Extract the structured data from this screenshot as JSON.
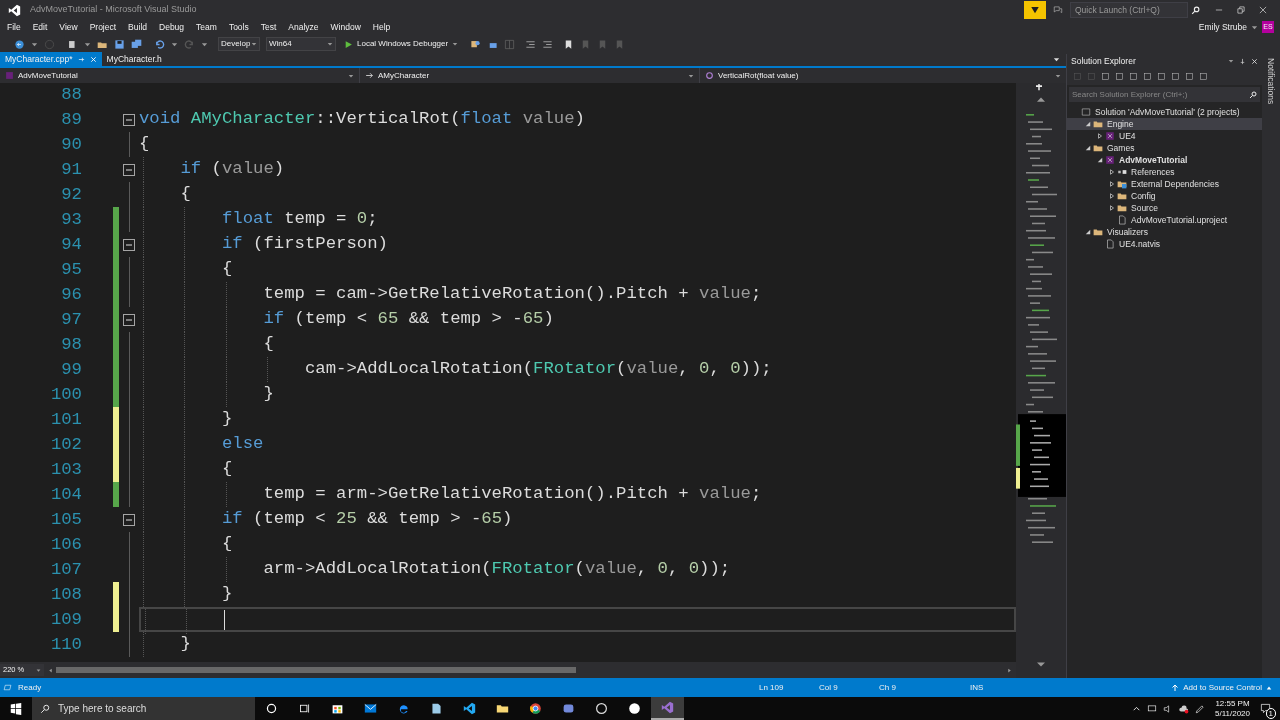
{
  "window": {
    "title": "AdvMoveTutorial - Microsoft Visual Studio"
  },
  "quick_launch": {
    "placeholder": "Quick Launch (Ctrl+Q)"
  },
  "menu": [
    "File",
    "Edit",
    "View",
    "Project",
    "Build",
    "Debug",
    "Team",
    "Tools",
    "Test",
    "Analyze",
    "Window",
    "Help"
  ],
  "account": {
    "name": "Emily Strube",
    "initials": "ES"
  },
  "toolbar": {
    "configuration": "Develop",
    "platform": "Win64",
    "debugger": "Local Windows Debugger"
  },
  "tabs": [
    {
      "label": "MyCharacter.cpp*",
      "selected": true
    },
    {
      "label": "MyCharacter.h",
      "selected": false
    }
  ],
  "navigation": {
    "project": "AdvMoveTutorial",
    "class": "AMyCharacter",
    "member": "VerticalRot(float value)"
  },
  "editor": {
    "zoom": "220 %",
    "lines": [
      {
        "number": "88",
        "fold": false,
        "current": false
      },
      {
        "number": "89",
        "fold": true,
        "current": false,
        "tokens": [
          {
            "kind": "keyword",
            "text": "void"
          },
          {
            "kind": "type",
            "text": " AMyCharacter"
          },
          {
            "kind": "plain",
            "text": "::VerticalRot("
          },
          {
            "kind": "keyword",
            "text": "float"
          },
          {
            "kind": "parameter",
            "text": " value"
          },
          {
            "kind": "plain",
            "text": ")"
          }
        ]
      },
      {
        "number": "90",
        "fold": false,
        "current": false,
        "tokens": [
          {
            "kind": "plain",
            "text": "{"
          }
        ]
      },
      {
        "number": "91",
        "fold": true,
        "current": false,
        "tokens": [
          {
            "kind": "keyword",
            "text": "    if"
          },
          {
            "kind": "plain",
            "text": " ("
          },
          {
            "kind": "parameter",
            "text": "value"
          },
          {
            "kind": "plain",
            "text": ")"
          }
        ]
      },
      {
        "number": "92",
        "fold": false,
        "current": false,
        "tokens": [
          {
            "kind": "plain",
            "text": "    {"
          }
        ]
      },
      {
        "number": "93",
        "fold": false,
        "color": "#57a64a",
        "current": false,
        "tokens": [
          {
            "kind": "keyword",
            "text": "        float"
          },
          {
            "kind": "plain",
            "text": " temp = "
          },
          {
            "kind": "number",
            "text": "0"
          },
          {
            "kind": "plain",
            "text": ";"
          }
        ]
      },
      {
        "number": "94",
        "fold": true,
        "color": "#57a64a",
        "current": false,
        "tokens": [
          {
            "kind": "keyword",
            "text": "        if"
          },
          {
            "kind": "plain",
            "text": " (firstPerson)"
          }
        ]
      },
      {
        "number": "95",
        "fold": false,
        "color": "#57a64a",
        "current": false,
        "tokens": [
          {
            "kind": "plain",
            "text": "        {"
          }
        ]
      },
      {
        "number": "96",
        "fold": false,
        "color": "#57a64a",
        "current": false,
        "tokens": [
          {
            "kind": "plain",
            "text": "            temp = cam->GetRelativeRotation().Pitch + "
          },
          {
            "kind": "parameter",
            "text": "value"
          },
          {
            "kind": "plain",
            "text": ";"
          }
        ]
      },
      {
        "number": "97",
        "fold": true,
        "color": "#57a64a",
        "current": false,
        "tokens": [
          {
            "kind": "keyword",
            "text": "            if"
          },
          {
            "kind": "plain",
            "text": " (temp < "
          },
          {
            "kind": "number",
            "text": "65"
          },
          {
            "kind": "plain",
            "text": " && temp > -"
          },
          {
            "kind": "number",
            "text": "65"
          },
          {
            "kind": "plain",
            "text": ")"
          }
        ]
      },
      {
        "number": "98",
        "fold": false,
        "color": "#57a64a",
        "current": false,
        "tokens": [
          {
            "kind": "plain",
            "text": "            {"
          }
        ]
      },
      {
        "number": "99",
        "fold": false,
        "color": "#57a64a",
        "current": false,
        "tokens": [
          {
            "kind": "plain",
            "text": "                cam->AddLocalRotation("
          },
          {
            "kind": "type",
            "text": "FRotator"
          },
          {
            "kind": "plain",
            "text": "("
          },
          {
            "kind": "parameter",
            "text": "value"
          },
          {
            "kind": "plain",
            "text": ", "
          },
          {
            "kind": "number",
            "text": "0"
          },
          {
            "kind": "plain",
            "text": ", "
          },
          {
            "kind": "number",
            "text": "0"
          },
          {
            "kind": "plain",
            "text": "));"
          }
        ]
      },
      {
        "number": "100",
        "fold": false,
        "color": "#57a64a",
        "current": false,
        "tokens": [
          {
            "kind": "plain",
            "text": "            }"
          }
        ]
      },
      {
        "number": "101",
        "fold": false,
        "color": "#efef91",
        "current": false,
        "tokens": [
          {
            "kind": "plain",
            "text": "        }"
          }
        ]
      },
      {
        "number": "102",
        "fold": false,
        "color": "#efef91",
        "current": false,
        "tokens": [
          {
            "kind": "keyword",
            "text": "        else"
          }
        ]
      },
      {
        "number": "103",
        "fold": false,
        "color": "#efef91",
        "current": false,
        "tokens": [
          {
            "kind": "plain",
            "text": "        {"
          }
        ]
      },
      {
        "number": "104",
        "fold": false,
        "color": "#57a64a",
        "current": false,
        "tokens": [
          {
            "kind": "plain",
            "text": "            temp = arm->GetRelativeRotation().Pitch + "
          },
          {
            "kind": "parameter",
            "text": "value"
          },
          {
            "kind": "plain",
            "text": ";"
          }
        ]
      },
      {
        "number": "105",
        "fold": true,
        "current": false,
        "tokens": [
          {
            "kind": "keyword",
            "text": "        if"
          },
          {
            "kind": "plain",
            "text": " (temp < "
          },
          {
            "kind": "number",
            "text": "25"
          },
          {
            "kind": "plain",
            "text": " && temp > -"
          },
          {
            "kind": "number",
            "text": "65"
          },
          {
            "kind": "plain",
            "text": ")"
          }
        ]
      },
      {
        "number": "106",
        "fold": false,
        "current": false,
        "tokens": [
          {
            "kind": "plain",
            "text": "        {"
          }
        ]
      },
      {
        "number": "107",
        "fold": false,
        "current": false,
        "tokens": [
          {
            "kind": "plain",
            "text": "            arm->AddLocalRotation("
          },
          {
            "kind": "type",
            "text": "FRotator"
          },
          {
            "kind": "plain",
            "text": "("
          },
          {
            "kind": "parameter",
            "text": "value"
          },
          {
            "kind": "plain",
            "text": ", "
          },
          {
            "kind": "number",
            "text": "0"
          },
          {
            "kind": "plain",
            "text": ", "
          },
          {
            "kind": "number",
            "text": "0"
          },
          {
            "kind": "plain",
            "text": "));"
          }
        ]
      },
      {
        "number": "108",
        "fold": false,
        "color": "#efef91",
        "current": false,
        "tokens": [
          {
            "kind": "plain",
            "text": "        }"
          }
        ]
      },
      {
        "number": "109",
        "fold": false,
        "color": "#efef91",
        "current": true
      },
      {
        "number": "110",
        "fold": false,
        "current": false,
        "tokens": [
          {
            "kind": "plain",
            "text": "    }"
          }
        ]
      }
    ]
  },
  "solution_explorer": {
    "title": "Solution Explorer",
    "search": {
      "placeholder": "Search Solution Explorer (Ctrl+;)"
    },
    "tree": [
      {
        "label": "Solution 'AdvMoveTutorial' (2 projects)",
        "kind": "solution",
        "selected": false,
        "children": [
          {
            "label": "Engine",
            "kind": "folder",
            "expanded": true,
            "selected": true,
            "children": [
              {
                "label": "UE4",
                "kind": "project",
                "expanded": false,
                "selected": false
              }
            ]
          },
          {
            "label": "Games",
            "kind": "folder",
            "expanded": true,
            "selected": false,
            "children": [
              {
                "label": "AdvMoveTutorial",
                "kind": "startup-project",
                "expanded": true,
                "selected": false,
                "children": [
                  {
                    "label": "References",
                    "kind": "references",
                    "expanded": false,
                    "selected": false
                  },
                  {
                    "label": "External Dependencies",
                    "kind": "dependencies",
                    "expanded": false,
                    "selected": false
                  },
                  {
                    "label": "Config",
                    "kind": "folder",
                    "expanded": false,
                    "selected": false
                  },
                  {
                    "label": "Source",
                    "kind": "folder",
                    "expanded": false,
                    "selected": false
                  },
                  {
                    "label": "AdvMoveTutorial.uproject",
                    "kind": "file",
                    "selected": false
                  }
                ]
              }
            ]
          },
          {
            "label": "Visualizers",
            "kind": "folder",
            "expanded": true,
            "selected": false,
            "children": [
              {
                "label": "UE4.natvis",
                "kind": "file",
                "selected": false
              }
            ]
          }
        ]
      }
    ]
  },
  "notifications_tab": "Notifications",
  "status_bar": {
    "state": "Ready",
    "line": "Ln 109",
    "col": "Col 9",
    "ch": "Ch 9",
    "mode": "INS",
    "source_control": "Add to Source Control"
  },
  "taskbar": {
    "search": {
      "placeholder": "Type here to search"
    },
    "time": "12:55 PM",
    "date": "5/11/2020",
    "notification_count": "1"
  }
}
